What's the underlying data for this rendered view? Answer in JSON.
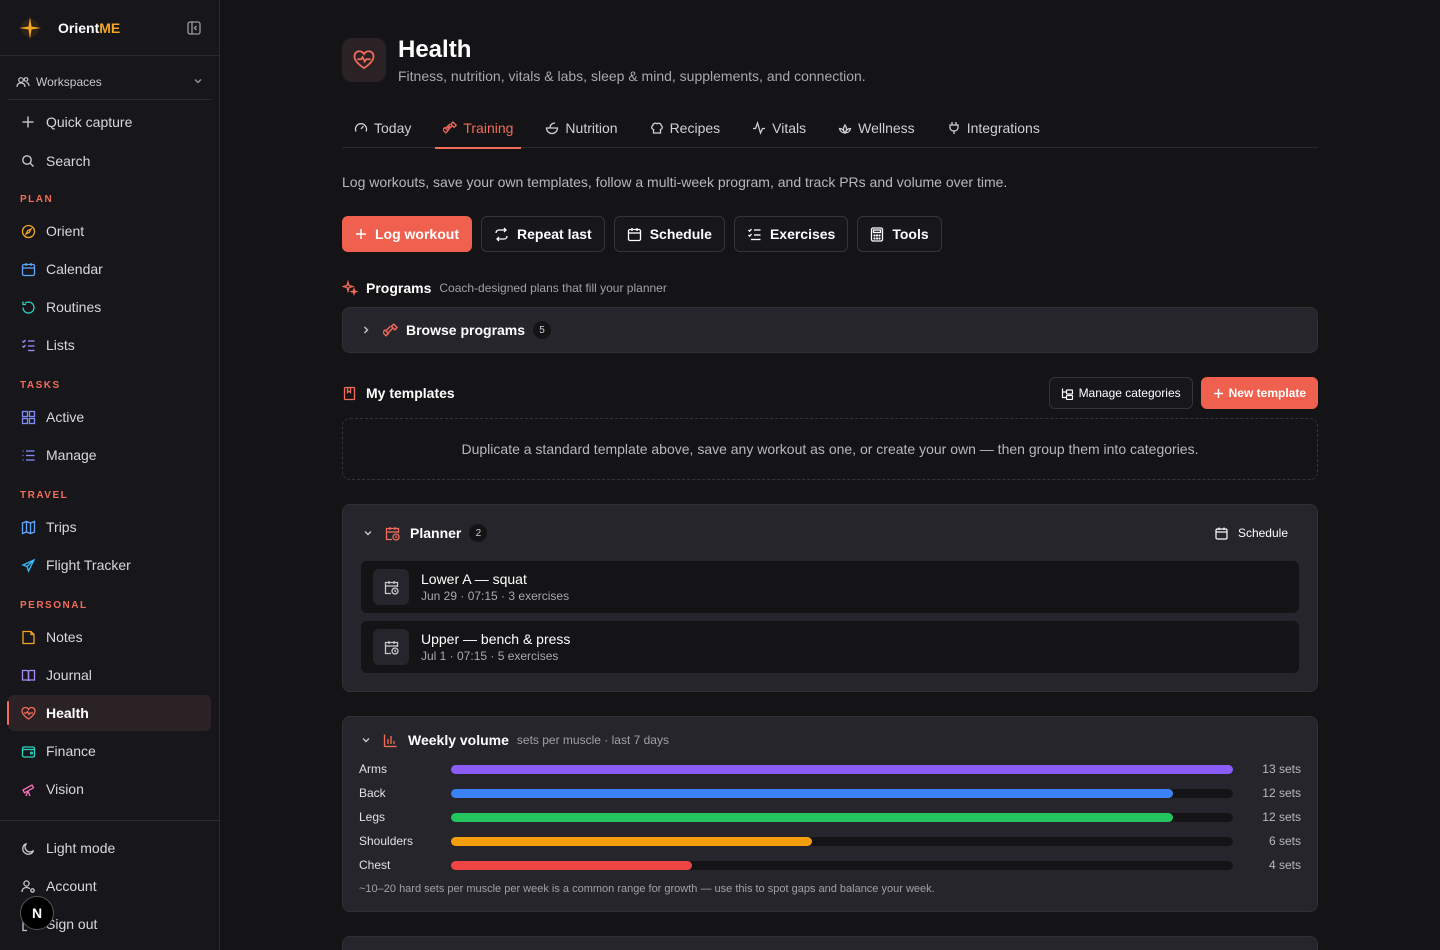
{
  "brand": {
    "name_main": "Orient",
    "name_accent": "ME"
  },
  "workspaces": {
    "label": "Workspaces"
  },
  "quick": [
    {
      "label": "Quick capture",
      "icon": "plus-icon"
    },
    {
      "label": "Search",
      "icon": "search-icon"
    }
  ],
  "sections": {
    "plan": "PLAN",
    "tasks": "TASKS",
    "travel": "TRAVEL",
    "personal": "PERSONAL"
  },
  "nav": {
    "plan": [
      {
        "label": "Orient",
        "icon": "compass-icon"
      },
      {
        "label": "Calendar",
        "icon": "calendar-icon"
      },
      {
        "label": "Routines",
        "icon": "refresh-icon"
      },
      {
        "label": "Lists",
        "icon": "checklist-icon"
      }
    ],
    "tasks": [
      {
        "label": "Active",
        "icon": "grid-icon"
      },
      {
        "label": "Manage",
        "icon": "list-icon"
      }
    ],
    "travel": [
      {
        "label": "Trips",
        "icon": "map-icon"
      },
      {
        "label": "Flight Tracker",
        "icon": "plane-icon"
      }
    ],
    "personal": [
      {
        "label": "Notes",
        "icon": "note-icon"
      },
      {
        "label": "Journal",
        "icon": "book-icon"
      },
      {
        "label": "Health",
        "icon": "heart-pulse-icon"
      },
      {
        "label": "Finance",
        "icon": "wallet-icon"
      },
      {
        "label": "Vision",
        "icon": "telescope-icon"
      }
    ]
  },
  "bottom": [
    {
      "label": "Light mode",
      "icon": "moon-icon"
    },
    {
      "label": "Account",
      "icon": "user-gear-icon"
    },
    {
      "label": "Sign out",
      "icon": "logout-icon"
    }
  ],
  "avatar": {
    "initial": "N"
  },
  "header": {
    "title": "Health",
    "subtitle": "Fitness, nutrition, vitals & labs, sleep & mind, supplements, and connection."
  },
  "tabs": [
    {
      "label": "Today",
      "icon": "gauge-icon"
    },
    {
      "label": "Training",
      "icon": "dumbbell-icon",
      "active": true
    },
    {
      "label": "Nutrition",
      "icon": "bowl-icon"
    },
    {
      "label": "Recipes",
      "icon": "chef-hat-icon"
    },
    {
      "label": "Vitals",
      "icon": "activity-icon"
    },
    {
      "label": "Wellness",
      "icon": "lotus-icon"
    },
    {
      "label": "Integrations",
      "icon": "plug-icon"
    }
  ],
  "lead": "Log workouts, save your own templates, follow a multi-week program, and track PRs and volume over time.",
  "actions": {
    "log": "Log workout",
    "repeat": "Repeat last",
    "schedule": "Schedule",
    "exercises": "Exercises",
    "tools": "Tools"
  },
  "programs": {
    "title": "Programs",
    "note": "Coach-designed plans that fill your planner",
    "browse_label": "Browse programs",
    "count": "5"
  },
  "templates": {
    "title": "My templates",
    "manage": "Manage categories",
    "new": "New template",
    "empty": "Duplicate a standard template above, save any workout as one, or create your own — then group them into categories."
  },
  "planner": {
    "title": "Planner",
    "count": "2",
    "schedule": "Schedule",
    "items": [
      {
        "title": "Lower A — squat",
        "sub": "Jun 29 · 07:15 · 3 exercises"
      },
      {
        "title": "Upper — bench & press",
        "sub": "Jul 1 · 07:15 · 5 exercises"
      }
    ]
  },
  "volume": {
    "title": "Weekly volume",
    "note": "sets per muscle · last 7 days",
    "max": 13,
    "rows": [
      {
        "label": "Arms",
        "value": 13,
        "display": "13 sets",
        "color": "#8b5cf6"
      },
      {
        "label": "Back",
        "value": 12,
        "display": "12 sets",
        "color": "#3b82f6"
      },
      {
        "label": "Legs",
        "value": 12,
        "display": "12 sets",
        "color": "#22c55e"
      },
      {
        "label": "Shoulders",
        "value": 6,
        "display": "6 sets",
        "color": "#f59e0b"
      },
      {
        "label": "Chest",
        "value": 4,
        "display": "4 sets",
        "color": "#ef4444"
      }
    ],
    "footnote": "~10–20 hard sets per muscle per week is a common range for growth — use this to spot gaps and balance your week."
  },
  "colors": {
    "accent": "#f0604e",
    "brand_accent": "#f5a524"
  }
}
